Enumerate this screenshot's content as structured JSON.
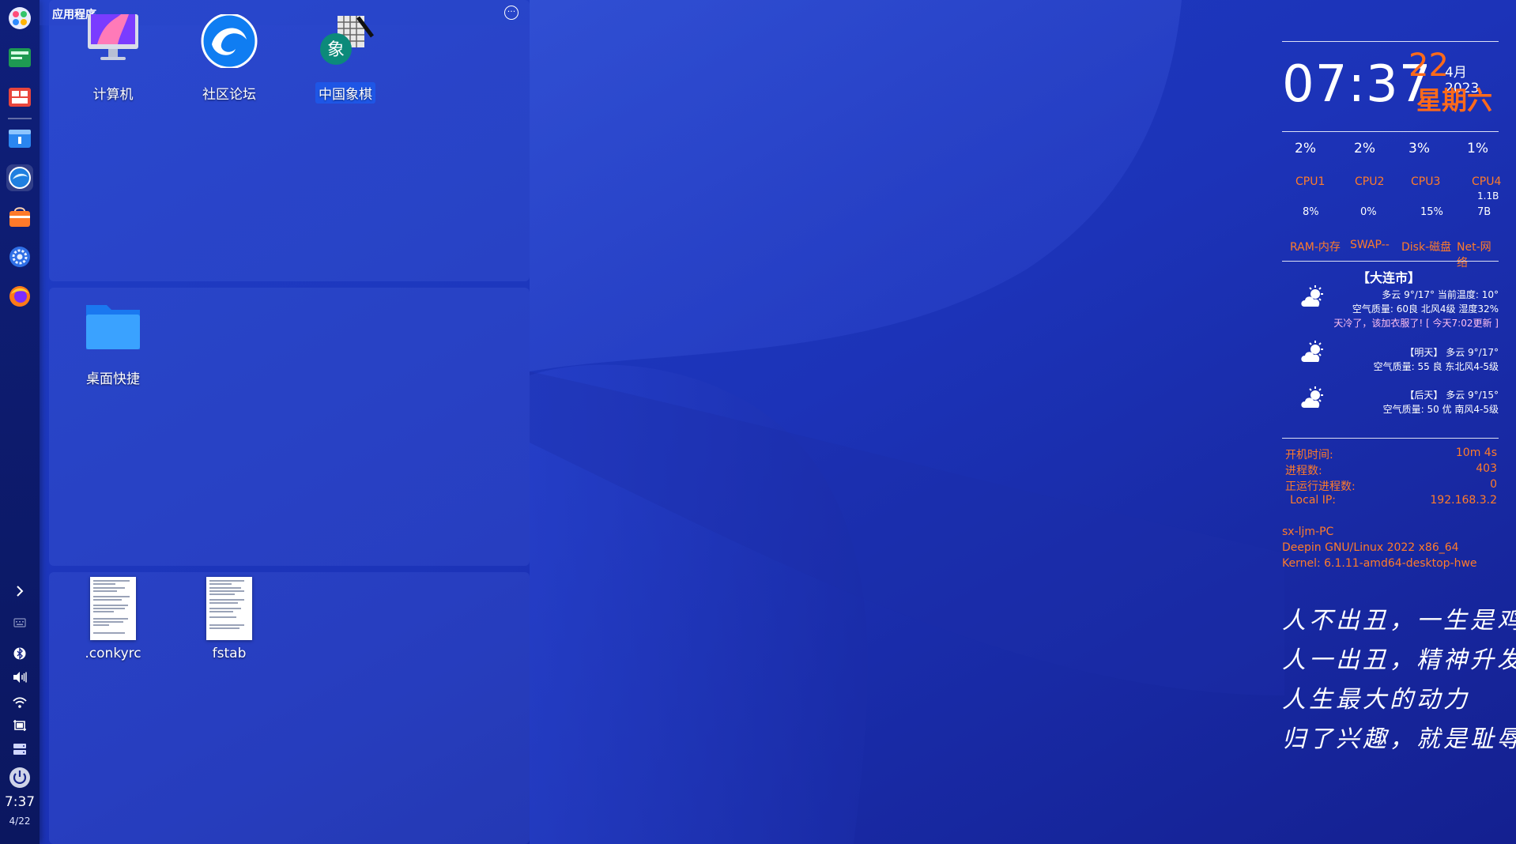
{
  "launcher": {
    "title": "应用程序",
    "menu_icon": "ellipsis-icon",
    "apps": [
      {
        "label": "计算机",
        "icon": "computer-icon"
      },
      {
        "label": "社区论坛",
        "icon": "deepin-forum-icon"
      },
      {
        "label": "中国象棋",
        "icon": "chinese-chess-icon",
        "selected": true
      }
    ],
    "folders": [
      {
        "label": "桌面快捷",
        "icon": "folder-icon"
      }
    ],
    "files": [
      {
        "label": ".conkyrc",
        "icon": "text-file-icon"
      },
      {
        "label": "fstab",
        "icon": "text-file-icon"
      }
    ]
  },
  "dock": {
    "apps": [
      {
        "name": "launcher",
        "icon": "launcher-icon"
      },
      {
        "name": "terminal",
        "icon": "terminal-icon"
      },
      {
        "name": "multitask",
        "icon": "multitask-icon"
      },
      {
        "name": "file-manager",
        "icon": "file-manager-icon"
      },
      {
        "name": "browser",
        "icon": "browser-icon"
      },
      {
        "name": "app-store",
        "icon": "app-store-icon"
      },
      {
        "name": "settings",
        "icon": "settings-icon"
      },
      {
        "name": "firefox",
        "icon": "firefox-icon"
      }
    ],
    "tray": [
      "chevron-right-icon",
      "keyboard-icon",
      "bluetooth-icon",
      "volume-icon",
      "wifi-icon",
      "screenshot-icon",
      "storage-icon",
      "power-icon"
    ],
    "time": "7:37",
    "date": "4/22"
  },
  "conky": {
    "time": "07:37",
    "day": "22",
    "month_year": "4月 2023",
    "weekday": "星期六",
    "cpu_percents": [
      "2%",
      "2%",
      "3%",
      "1%"
    ],
    "cpu_labels": [
      "CPU1",
      "CPU2",
      "CPU3",
      "CPU4"
    ],
    "stat_values": [
      "8%",
      "0%",
      "15%",
      "7B"
    ],
    "net_extra": "1.1B",
    "stat_labels": [
      "RAM-内存",
      "SWAP--",
      "Disk-磁盘",
      "Net-网络"
    ],
    "weather": {
      "city": "【大连市】",
      "today_line1": "多云   9°/17°  当前温度: 10°",
      "today_line2": "空气质量: 60良    北风4级    湿度32%",
      "today_line3": "天冷了，该加衣服了!    [ 今天7:02更新 ]",
      "tomorrow_line1": "【明天】  多云    9°/17°",
      "tomorrow_line2": "空气质量: 55 良   东北风4-5级",
      "after_line1": "【后天】    多云     9°/15°",
      "after_line2": "空气质量: 50 优   南风4-5级",
      "icon": "partly-cloudy-icon"
    },
    "system": {
      "uptime_label": "开机时间:",
      "uptime_value": "10m 4s",
      "procs_label": "进程数:",
      "procs_value": "403",
      "running_label": "正运行进程数:",
      "running_value": "0",
      "ip_label": "Local IP:",
      "ip_value": "192.168.3.2"
    },
    "host": "sx-ljm-PC",
    "os": "Deepin GNU/Linux 2022  x86_64",
    "kernel": "Kernel: 6.1.11-amd64-desktop-hwe",
    "poem": [
      "人不出丑，一生是鸡",
      "人一出丑，精神升发",
      "人生最大的动力",
      "归了兴趣，就是耻辱"
    ]
  },
  "colors": {
    "accent_orange": "#ff6a1a",
    "selection_blue": "#1e56e6",
    "wallpaper_blue": "#1a2fb0"
  }
}
